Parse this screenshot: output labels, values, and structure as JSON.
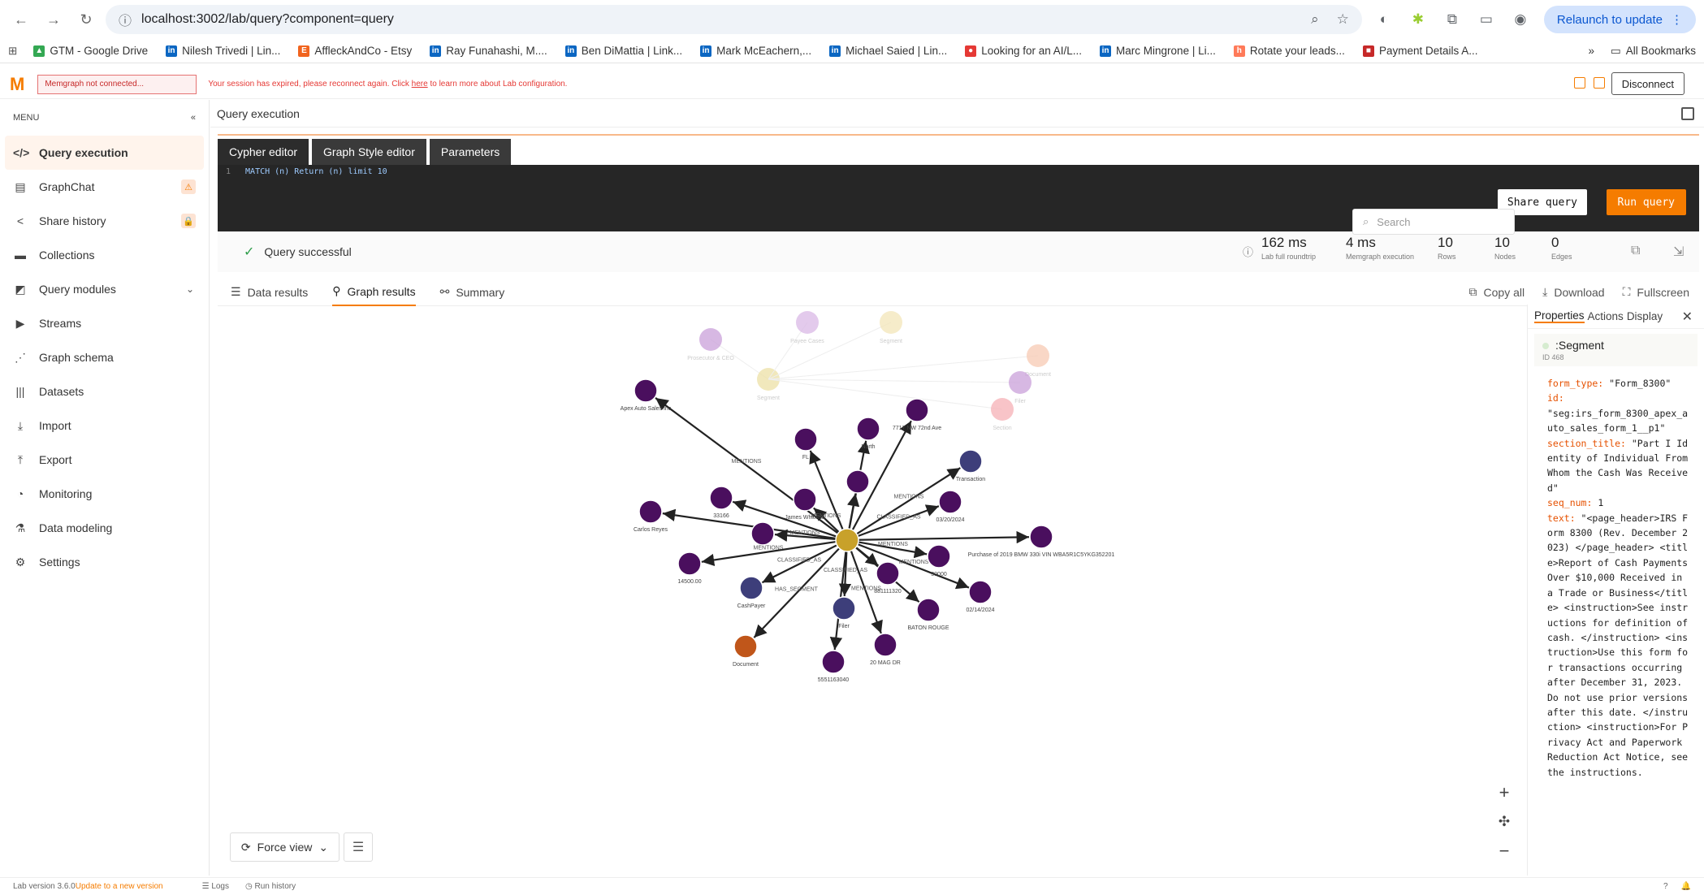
{
  "browser": {
    "url": "localhost:3002/lab/query?component=query",
    "relaunch": "Relaunch to update"
  },
  "bookmarks": [
    {
      "label": "GTM - Google Drive",
      "color": "#34a853",
      "ch": "▲"
    },
    {
      "label": "Nilesh Trivedi | Lin...",
      "color": "#0a66c2",
      "ch": "in"
    },
    {
      "label": "AffleckAndCo - Etsy",
      "color": "#f1641e",
      "ch": "E"
    },
    {
      "label": "Ray Funahashi, M....",
      "color": "#0a66c2",
      "ch": "in"
    },
    {
      "label": "Ben DiMattia | Link...",
      "color": "#0a66c2",
      "ch": "in"
    },
    {
      "label": "Mark McEachern,...",
      "color": "#0a66c2",
      "ch": "in"
    },
    {
      "label": "Michael Saied | Lin...",
      "color": "#0a66c2",
      "ch": "in"
    },
    {
      "label": "Looking for an AI/L...",
      "color": "#e53935",
      "ch": "●"
    },
    {
      "label": "Marc Mingrone | Li...",
      "color": "#0a66c2",
      "ch": "in"
    },
    {
      "label": "Rotate your leads...",
      "color": "#ff7a59",
      "ch": "h"
    },
    {
      "label": "Payment Details A...",
      "color": "#c62828",
      "ch": "■"
    }
  ],
  "bookmarks_more": "»",
  "all_bookmarks": "All Bookmarks",
  "app": {
    "conn_status": "Memgraph not connected...",
    "session_msg_pre": "Your session has expired, please reconnect again. Click ",
    "session_link": "here",
    "session_msg_post": " to learn more about Lab configuration.",
    "disconnect": "Disconnect"
  },
  "menu": {
    "title": "MENU",
    "items": [
      {
        "label": "Query execution",
        "icon": "</>",
        "name": "sidebar-item-query-execution",
        "active": true
      },
      {
        "label": "GraphChat",
        "icon": "▤",
        "name": "sidebar-item-graphchat",
        "lock": "warn"
      },
      {
        "label": "Share history",
        "icon": "<",
        "name": "sidebar-item-share-history",
        "lock": "lock"
      },
      {
        "label": "Collections",
        "icon": "▬",
        "name": "sidebar-item-collections"
      },
      {
        "label": "Query modules",
        "icon": "◩",
        "name": "sidebar-item-query-modules",
        "chevron": true
      },
      {
        "label": "Streams",
        "icon": "▶",
        "name": "sidebar-item-streams"
      },
      {
        "label": "Graph schema",
        "icon": "⋰",
        "name": "sidebar-item-graph-schema"
      },
      {
        "label": "Datasets",
        "icon": "|||",
        "name": "sidebar-item-datasets"
      },
      {
        "label": "Import",
        "icon": "⤓",
        "name": "sidebar-item-import"
      },
      {
        "label": "Export",
        "icon": "⤒",
        "name": "sidebar-item-export"
      },
      {
        "label": "Monitoring",
        "icon": "◔",
        "name": "sidebar-item-monitoring"
      },
      {
        "label": "Data modeling",
        "icon": "⚗",
        "name": "sidebar-item-data-modeling"
      },
      {
        "label": "Settings",
        "icon": "⚙",
        "name": "sidebar-item-settings"
      }
    ]
  },
  "query": {
    "header": "Query execution",
    "tabs": [
      "Cypher editor",
      "Graph Style editor",
      "Parameters"
    ],
    "line_no": "1",
    "code": "MATCH (n) Return (n) limit 10",
    "share": "Share query",
    "run": "Run query"
  },
  "status": {
    "message": "Query successful",
    "stats": [
      {
        "value": "162 ms",
        "label": "Lab full roundtrip"
      },
      {
        "value": "4 ms",
        "label": "Memgraph execution"
      },
      {
        "value": "10",
        "label": "Rows"
      },
      {
        "value": "10",
        "label": "Nodes"
      },
      {
        "value": "0",
        "label": "Edges"
      }
    ]
  },
  "results": {
    "tabs": [
      "Data results",
      "Graph results",
      "Summary"
    ],
    "actions": [
      "Copy all",
      "Download",
      "Fullscreen"
    ],
    "search_placeholder": "Search",
    "force_view": "Force view"
  },
  "properties": {
    "tabs": [
      "Properties",
      "Actions",
      "Display"
    ],
    "label": ":Segment",
    "id": "ID 468",
    "lines": [
      {
        "k": "form_type:",
        "v": " \"Form_8300\""
      },
      {
        "k": "id:",
        "v": "\n\"seg:irs_form_8300_apex_auto_sales_form_1__p1\""
      },
      {
        "k": "section_title:",
        "v": " \"Part I Identity of Individual From Whom the Cash Was Received\""
      },
      {
        "k": "seq_num:",
        "v": " 1"
      },
      {
        "k": "text:",
        "v": " \"<page_header>IRS Form 8300 (Rev. December 2023) </page_header> <title>Report of Cash Payments Over $10,000 Received in a Trade or Business</title> <instruction>See instructions for definition of cash. </instruction> <instruction>Use this form for transactions occurring after December 31, 2023. Do not use prior versions after this date. </instruction> <instruction>For Privacy Act and Paperwork Reduction Act Notice, see the instructions."
      }
    ]
  },
  "footer": {
    "version": "Lab version 3.6.0",
    "update": " Update to a new version",
    "logs": "Logs",
    "history": "Run history"
  },
  "graph": {
    "center": {
      "label": "",
      "color": "#c8a12a"
    },
    "nodes": [
      {
        "label": "Apex Auto Sales Inc",
        "color": "#4a0f5e",
        "edge": "MENTIONS"
      },
      {
        "label": "FL",
        "color": "#4a0f5e",
        "edge": ""
      },
      {
        "label": "North",
        "color": "#4a0f5e",
        "edge": ""
      },
      {
        "label": "7717 NW 72nd Ave",
        "color": "#4a0f5e",
        "edge": ""
      },
      {
        "label": "Transaction",
        "color": "#3d3e7a",
        "edge": "MENTIONS"
      },
      {
        "label": "James Whitfield",
        "color": "#4a0f5e",
        "edge": "MENTIONS"
      },
      {
        "label": "03/20/2024",
        "color": "#4a0f5e",
        "edge": "CLASSIFIED_AS"
      },
      {
        "label": "Purchase of 2019 BMW 330i VIN WBA5R1C5YKG352201",
        "color": "#4a0f5e",
        "edge": ""
      },
      {
        "label": "33166",
        "color": "#4a0f5e",
        "edge": ""
      },
      {
        "label": "",
        "color": "#4a0f5e",
        "edge": ""
      },
      {
        "label": "Carlos Reyes",
        "color": "#4a0f5e",
        "edge": ""
      },
      {
        "label": "",
        "color": "#4a0f5e",
        "edge": "MENTIONS"
      },
      {
        "label": "14500.00",
        "color": "#4a0f5e",
        "edge": "MENTIONS"
      },
      {
        "label": "CashPayer",
        "color": "#3d3e7a",
        "edge": "CLASSIFIED_AS"
      },
      {
        "label": "Document",
        "color": "#c0561a",
        "edge": "HAS_SEGMENT"
      },
      {
        "label": "5551163040",
        "color": "#4a0f5e",
        "edge": ""
      },
      {
        "label": "Filer",
        "color": "#3d3e7a",
        "edge": "CLASSIFIED_AS"
      },
      {
        "label": "20 MAG DR",
        "color": "#4a0f5e",
        "edge": "MENTIONS"
      },
      {
        "label": "BATON ROUGE",
        "color": "#4a0f5e",
        "edge": ""
      },
      {
        "label": "02/14/2024",
        "color": "#4a0f5e",
        "edge": "MENTIONS"
      },
      {
        "label": "30000",
        "color": "#4a0f5e",
        "edge": "MENTIONS"
      },
      {
        "label": "881111320",
        "color": "#4a0f5e",
        "edge": ""
      }
    ],
    "faded": [
      {
        "label": "Prosecutor & CEO",
        "color": "#c9a0d9"
      },
      {
        "label": "Segment",
        "color": "#ece0a5"
      },
      {
        "label": "Document",
        "color": "#f7c9b3"
      },
      {
        "label": "Filer",
        "color": "#c9a0d9"
      },
      {
        "label": "Section",
        "color": "#f5b0b5"
      },
      {
        "label": "Segment",
        "color": "#f3e6b8"
      },
      {
        "label": "Payee Cases",
        "color": "#d9b8e6"
      }
    ]
  }
}
